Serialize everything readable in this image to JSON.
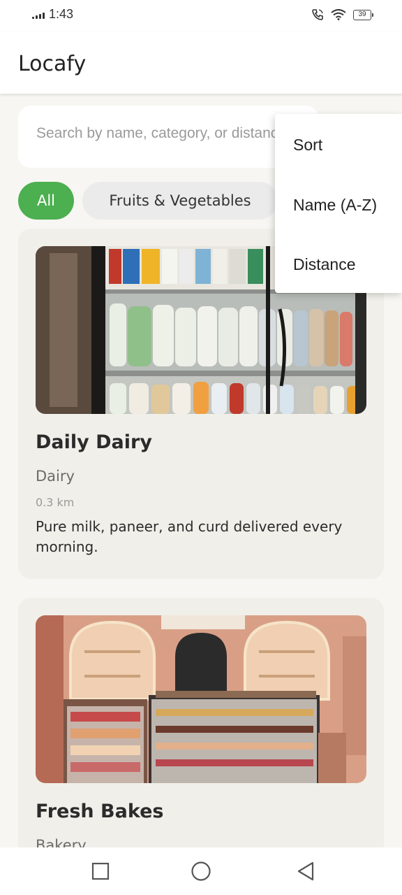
{
  "status_bar": {
    "time": "1:43",
    "battery": "39",
    "icons": [
      "signal-icon",
      "call-icon",
      "wifi-icon",
      "battery-icon"
    ]
  },
  "app_bar": {
    "title": "Locafy"
  },
  "search": {
    "placeholder": "Search by name, category, or distance"
  },
  "filters": {
    "chips": [
      {
        "label": "All",
        "selected": true
      },
      {
        "label": "Fruits & Vegetables",
        "selected": false
      }
    ]
  },
  "sort_menu": {
    "items": [
      {
        "label": "Sort"
      },
      {
        "label": "Name (A-Z)"
      },
      {
        "label": "Distance"
      }
    ]
  },
  "stores": [
    {
      "name": "Daily Dairy",
      "category": "Dairy",
      "distance": "0.3 km",
      "description": "Pure milk, paneer, and curd delivered every morning.",
      "image": "dairy-fridge-photo"
    },
    {
      "name": "Fresh Bakes",
      "category": "Bakery",
      "image": "bakery-display-photo"
    }
  ],
  "nav_bar": {
    "icons": [
      "recents-icon",
      "home-icon",
      "back-icon"
    ]
  },
  "colors": {
    "accent": "#4caf50",
    "background": "#f7f6f2",
    "card": "#f1efe9"
  }
}
